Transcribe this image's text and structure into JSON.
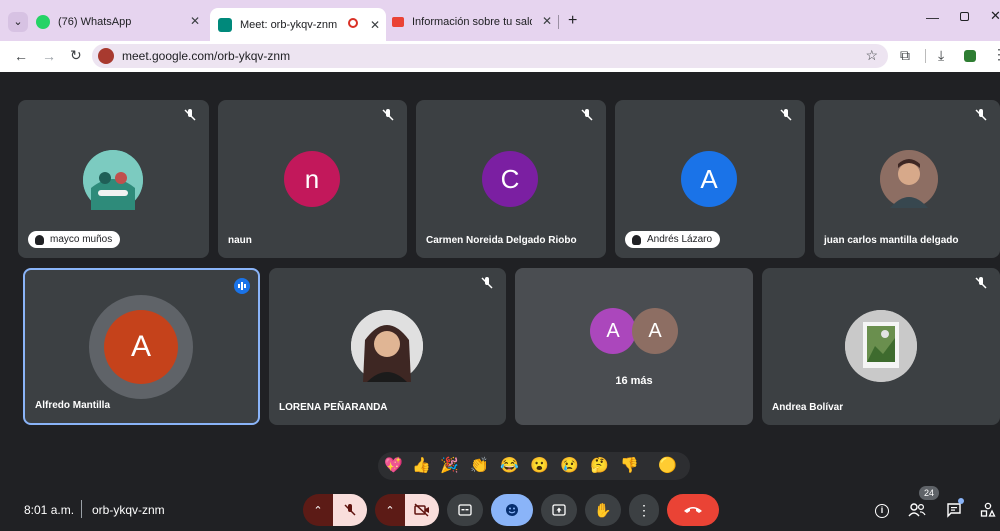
{
  "browser": {
    "tabs": [
      {
        "title": "(76) WhatsApp"
      },
      {
        "title": "Meet: orb-ykqv-znm"
      },
      {
        "title": "Información sobre tu saldo"
      }
    ],
    "url": "meet.google.com/orb-ykqv-znm"
  },
  "meet": {
    "participants": [
      {
        "name": "mayco muños",
        "initial": ""
      },
      {
        "name": "naun",
        "initial": "n"
      },
      {
        "name": "Carmen Noreida Delgado Riobo",
        "initial": "C"
      },
      {
        "name": "Andrés Lázaro",
        "initial": "A"
      },
      {
        "name": "juan carlos mantilla delgado",
        "initial": ""
      },
      {
        "name": "Alfredo Mantilla",
        "initial": "A"
      },
      {
        "name": "LORENA PEÑARANDA",
        "initial": ""
      },
      {
        "name": "Andrea Bolívar",
        "initial": ""
      }
    ],
    "more_tile": {
      "initials": [
        "A",
        "A"
      ],
      "label": "16 más"
    },
    "reactions": [
      "💖",
      "👍",
      "🎉",
      "👏",
      "😂",
      "😮",
      "😢",
      "🤔",
      "👎",
      "🟡"
    ],
    "time": "8:01 a.m.",
    "meeting_code": "orb-ykqv-znm",
    "participant_count": "24"
  },
  "colors": {
    "accent_blue": "#8ab4f8",
    "end_call": "#ea4335",
    "muted_dark": "#5c1b16"
  }
}
